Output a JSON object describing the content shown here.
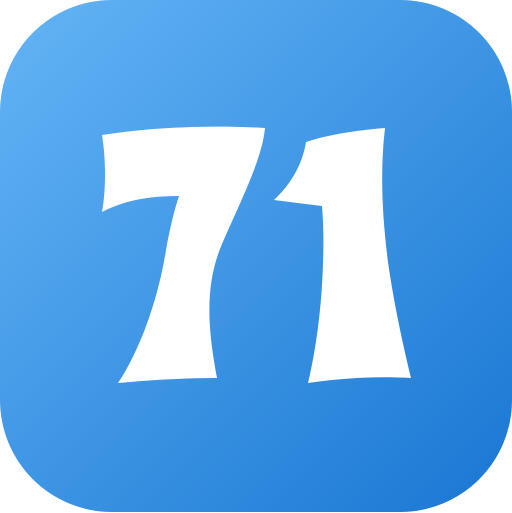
{
  "icon": {
    "name": "number-71-icon",
    "number_text": "71",
    "colors": {
      "gradient_start": "#64B5F6",
      "gradient_end": "#1976D2",
      "glyph": "#FFFFFF"
    }
  }
}
